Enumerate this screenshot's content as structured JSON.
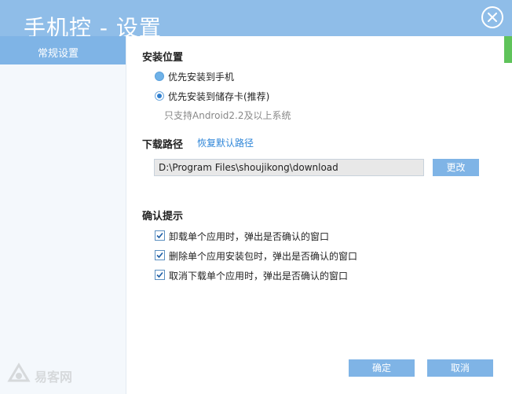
{
  "window": {
    "title": "手机控 - 设置",
    "close_icon": "close-circle-icon"
  },
  "sidebar": {
    "items": [
      {
        "label": "常规设置",
        "selected": true
      }
    ]
  },
  "install_location": {
    "title": "安装位置",
    "options": [
      {
        "label": "优先安装到手机",
        "selected": false
      },
      {
        "label": "优先安装到储存卡(推荐)",
        "selected": true
      }
    ],
    "hint": "只支持Android2.2及以上系统"
  },
  "download_path": {
    "title": "下载路径",
    "restore_link": "恢复默认路径",
    "value": "D:\\Program Files\\shoujikong\\download",
    "change_button": "更改"
  },
  "confirm_prompt": {
    "title": "确认提示",
    "items": [
      {
        "label": "卸载单个应用时，弹出是否确认的窗口",
        "checked": true
      },
      {
        "label": "删除单个应用安装包时，弹出是否确认的窗口",
        "checked": true
      },
      {
        "label": "取消下载单个应用时，弹出是否确认的窗口",
        "checked": true
      }
    ]
  },
  "footer": {
    "ok_button": "确定",
    "cancel_button": "取消"
  },
  "watermark": {
    "text": "易客网",
    "icon": "watermark-logo-icon"
  },
  "colors": {
    "titlebar": "#8fbde8",
    "accent": "#7fb4e6",
    "link": "#2f86d8",
    "status_green": "#5fc35a"
  }
}
